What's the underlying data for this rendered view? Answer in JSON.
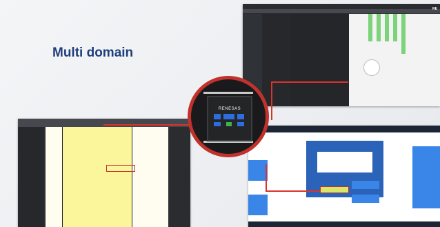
{
  "page": {
    "title": "Multi domain"
  },
  "top_screenshot": {
    "brand": "RE"
  },
  "chip": {
    "logo": "RENESAS"
  }
}
